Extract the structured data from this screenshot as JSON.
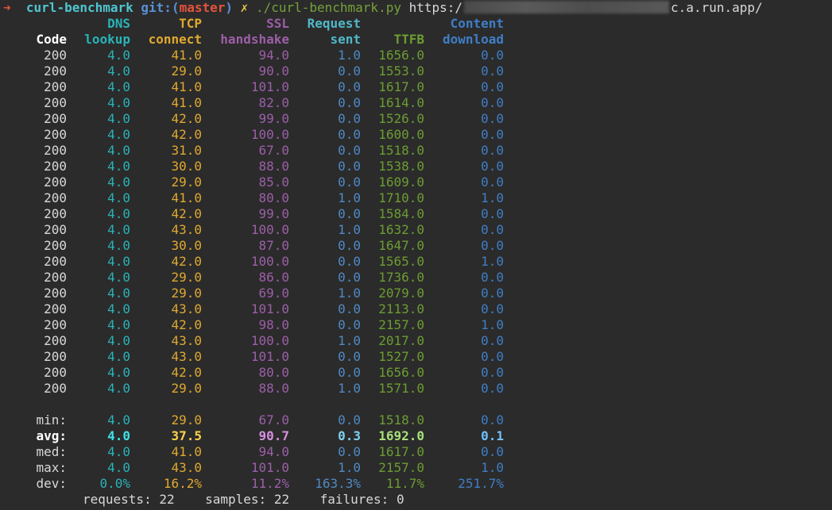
{
  "prompt": {
    "arrow": "➜",
    "directory": "curl-benchmark",
    "git_label": "git:(",
    "branch": "master",
    "git_close": ")",
    "dirty_mark": "✗",
    "command": "./curl-benchmark.py",
    "url_prefix": "https:/",
    "url_suffix": "c.a.run.app/"
  },
  "colors": {
    "code": "#d8d8d8",
    "dns": "#2ab3b7",
    "tcp": "#e0a92f",
    "ssl": "#9c5fa8",
    "request": "#4f8ac4",
    "ttfb": "#6d9c32",
    "content": "#3f7ec6"
  },
  "header_top": [
    "",
    "DNS",
    "TCP",
    "SSL",
    "Request",
    "",
    "Content"
  ],
  "header_bottom": [
    "Code",
    "lookup",
    "connect",
    "handshake",
    "sent",
    "TTFB",
    "download"
  ],
  "rows": [
    [
      "200",
      "4.0",
      "41.0",
      "94.0",
      "1.0",
      "1656.0",
      "0.0"
    ],
    [
      "200",
      "4.0",
      "29.0",
      "90.0",
      "0.0",
      "1553.0",
      "0.0"
    ],
    [
      "200",
      "4.0",
      "41.0",
      "101.0",
      "0.0",
      "1617.0",
      "0.0"
    ],
    [
      "200",
      "4.0",
      "41.0",
      "82.0",
      "0.0",
      "1614.0",
      "0.0"
    ],
    [
      "200",
      "4.0",
      "42.0",
      "99.0",
      "0.0",
      "1526.0",
      "0.0"
    ],
    [
      "200",
      "4.0",
      "42.0",
      "100.0",
      "0.0",
      "1600.0",
      "0.0"
    ],
    [
      "200",
      "4.0",
      "31.0",
      "67.0",
      "0.0",
      "1518.0",
      "0.0"
    ],
    [
      "200",
      "4.0",
      "30.0",
      "88.0",
      "0.0",
      "1538.0",
      "0.0"
    ],
    [
      "200",
      "4.0",
      "29.0",
      "85.0",
      "0.0",
      "1609.0",
      "0.0"
    ],
    [
      "200",
      "4.0",
      "41.0",
      "80.0",
      "1.0",
      "1710.0",
      "1.0"
    ],
    [
      "200",
      "4.0",
      "42.0",
      "99.0",
      "0.0",
      "1584.0",
      "0.0"
    ],
    [
      "200",
      "4.0",
      "43.0",
      "100.0",
      "1.0",
      "1632.0",
      "0.0"
    ],
    [
      "200",
      "4.0",
      "30.0",
      "87.0",
      "0.0",
      "1647.0",
      "0.0"
    ],
    [
      "200",
      "4.0",
      "42.0",
      "100.0",
      "0.0",
      "1565.0",
      "1.0"
    ],
    [
      "200",
      "4.0",
      "29.0",
      "86.0",
      "0.0",
      "1736.0",
      "0.0"
    ],
    [
      "200",
      "4.0",
      "29.0",
      "69.0",
      "1.0",
      "2079.0",
      "0.0"
    ],
    [
      "200",
      "4.0",
      "43.0",
      "101.0",
      "0.0",
      "2113.0",
      "0.0"
    ],
    [
      "200",
      "4.0",
      "42.0",
      "98.0",
      "0.0",
      "2157.0",
      "1.0"
    ],
    [
      "200",
      "4.0",
      "43.0",
      "100.0",
      "1.0",
      "2017.0",
      "0.0"
    ],
    [
      "200",
      "4.0",
      "43.0",
      "101.0",
      "0.0",
      "1527.0",
      "0.0"
    ],
    [
      "200",
      "4.0",
      "42.0",
      "80.0",
      "0.0",
      "1656.0",
      "0.0"
    ],
    [
      "200",
      "4.0",
      "29.0",
      "88.0",
      "1.0",
      "1571.0",
      "0.0"
    ]
  ],
  "stats": [
    {
      "cells": [
        "min:",
        "4.0",
        "29.0",
        "67.0",
        "0.0",
        "1518.0",
        "0.0"
      ],
      "bold": false
    },
    {
      "cells": [
        "avg:",
        "4.0",
        "37.5",
        "90.7",
        "0.3",
        "1692.0",
        "0.1"
      ],
      "bold": true
    },
    {
      "cells": [
        "med:",
        "4.0",
        "41.0",
        "94.0",
        "0.0",
        "1617.0",
        "0.0"
      ],
      "bold": false
    },
    {
      "cells": [
        "max:",
        "4.0",
        "43.0",
        "101.0",
        "1.0",
        "2157.0",
        "1.0"
      ],
      "bold": false
    },
    {
      "cells": [
        "dev:",
        "0.0%",
        "16.2%",
        "11.2%",
        "163.3%",
        "11.7%",
        "251.7%"
      ],
      "bold": false
    }
  ],
  "summary": "requests: 22    samples: 22    failures: 0"
}
